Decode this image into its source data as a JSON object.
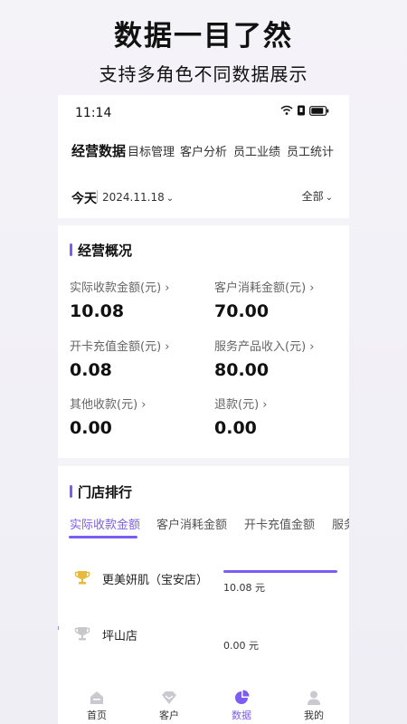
{
  "promo": {
    "title": "数据一目了然",
    "subtitle": "支持多角色不同数据展示"
  },
  "status_bar": {
    "time": "11:14",
    "icons": [
      "wifi-icon",
      "sim-icon",
      "battery-icon"
    ]
  },
  "tabs": [
    {
      "label": "经营数据",
      "active": true
    },
    {
      "label": "目标管理",
      "active": false
    },
    {
      "label": "客户分析",
      "active": false
    },
    {
      "label": "员工业绩",
      "active": false
    },
    {
      "label": "员工统计",
      "active": false
    }
  ],
  "date_filter": {
    "period": "今天",
    "date": "2024.11.18",
    "scope": "全部"
  },
  "overview": {
    "title": "经营概况",
    "metrics": [
      {
        "label": "实际收款金额(元) ›",
        "value": "10.08"
      },
      {
        "label": "客户消耗金额(元) ›",
        "value": "70.00"
      },
      {
        "label": "开卡充值金额(元) ›",
        "value": "0.08"
      },
      {
        "label": "服务产品收入(元) ›",
        "value": "80.00"
      },
      {
        "label": "其他收款(元) ›",
        "value": "0.00"
      },
      {
        "label": "退款(元) ›",
        "value": "0.00"
      }
    ]
  },
  "ranking": {
    "title": "门店排行",
    "tabs": [
      {
        "label": "实际收款金额",
        "active": true
      },
      {
        "label": "客户消耗金额",
        "active": false
      },
      {
        "label": "开卡充值金额",
        "active": false
      },
      {
        "label": "服务",
        "active": false
      }
    ],
    "stores": [
      {
        "name": "更美妍肌（宝安店）",
        "amount": "10.08 元",
        "share": 1.0,
        "icon": "gold-trophy-icon"
      },
      {
        "name": "坪山店",
        "amount": "0.00 元",
        "share": 0.0,
        "icon": "silver-trophy-icon"
      }
    ]
  },
  "bottom_nav": [
    {
      "label": "首页",
      "icon": "home-icon",
      "active": false
    },
    {
      "label": "客户",
      "icon": "diamond-icon",
      "active": false
    },
    {
      "label": "数据",
      "icon": "pie-chart-icon",
      "active": true
    },
    {
      "label": "我的",
      "icon": "user-icon",
      "active": false
    }
  ],
  "colors": {
    "accent": "#7d5cf6",
    "gold": "#e8b93a",
    "silver": "#c8c8cc"
  }
}
